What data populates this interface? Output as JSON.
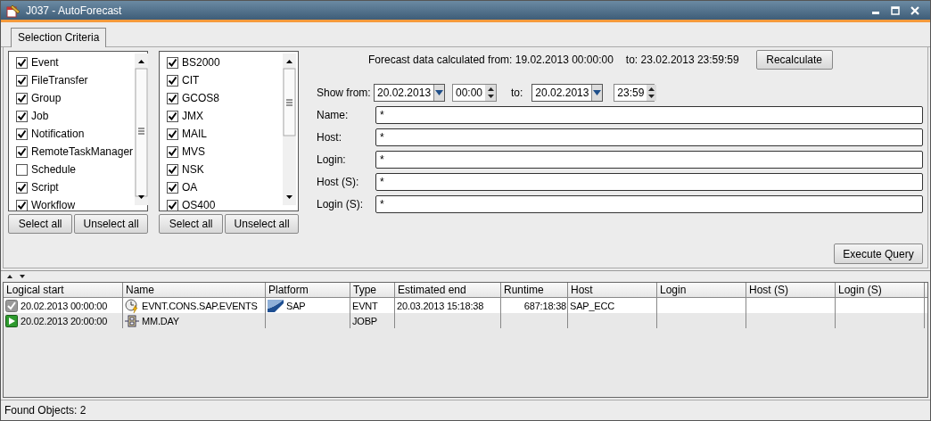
{
  "window": {
    "title": "J037 - AutoForecast"
  },
  "tabs": [
    {
      "label": "Selection Criteria",
      "selected": true
    }
  ],
  "object_types": {
    "items": [
      {
        "label": "Event",
        "checked": true
      },
      {
        "label": "FileTransfer",
        "checked": true
      },
      {
        "label": "Group",
        "checked": true
      },
      {
        "label": "Job",
        "checked": true
      },
      {
        "label": "Notification",
        "checked": true
      },
      {
        "label": "RemoteTaskManager",
        "checked": true
      },
      {
        "label": "Schedule",
        "checked": false
      },
      {
        "label": "Script",
        "checked": true
      },
      {
        "label": "Workflow",
        "checked": true
      }
    ],
    "buttons": [
      "Select all",
      "Unselect all"
    ]
  },
  "platforms": {
    "items": [
      {
        "label": "BS2000",
        "checked": true
      },
      {
        "label": "CIT",
        "checked": true
      },
      {
        "label": "GCOS8",
        "checked": true
      },
      {
        "label": "JMX",
        "checked": true
      },
      {
        "label": "MAIL",
        "checked": true
      },
      {
        "label": "MVS",
        "checked": true
      },
      {
        "label": "NSK",
        "checked": true
      },
      {
        "label": "OA",
        "checked": true
      },
      {
        "label": "OS400",
        "checked": true
      }
    ],
    "buttons": [
      "Select all",
      "Unselect all"
    ]
  },
  "forecast": {
    "from_text": "Forecast data calculated from: 19.02.2013 00:00:00",
    "to_text": "to: 23.02.2013 23:59:59",
    "button": "Recalculate"
  },
  "range": {
    "label": "Show from:",
    "from_date": "20.02.2013",
    "from_time": "00:00",
    "to_label": "to:",
    "to_date": "20.02.2013",
    "to_time": "23:59"
  },
  "filters": [
    {
      "label": "Name:",
      "value": "*"
    },
    {
      "label": "Host:",
      "value": "*"
    },
    {
      "label": "Login:",
      "value": "*"
    },
    {
      "label": "Host (S):",
      "value": "*"
    },
    {
      "label": "Login (S):",
      "value": "*"
    }
  ],
  "execute_button": "Execute Query",
  "table": {
    "columns": [
      "Logical start",
      "Name",
      "Platform",
      "Type",
      "Estimated end",
      "Runtime",
      "Host",
      "Login",
      "Host (S)",
      "Login (S)"
    ],
    "rows": [
      {
        "start_icon": {
          "kind": "done"
        },
        "name_icon": {
          "kind": "event"
        },
        "cells": [
          "20.02.2013 00:00:00",
          "EVNT.CONS.SAP.EVENTS",
          "SAP",
          "EVNT",
          "20.03.2013 15:18:38",
          "687:18:38",
          "SAP_ECC",
          "",
          "",
          ""
        ]
      },
      {
        "start_icon": {
          "kind": "scheduled"
        },
        "name_icon": {
          "kind": "workflow"
        },
        "cells": [
          "20.02.2013 20:00:00",
          "MM.DAY",
          "",
          "JOBP",
          "",
          "",
          "",
          "",
          "",
          ""
        ]
      }
    ]
  },
  "status_bar": "Found Objects: 2"
}
